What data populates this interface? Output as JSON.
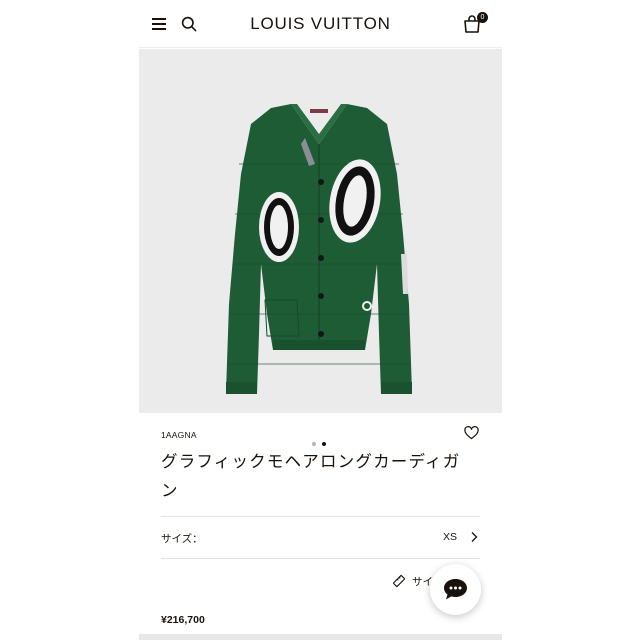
{
  "header": {
    "brand": "LOUIS VUITTON",
    "bag_count": "0"
  },
  "gallery": {
    "total_images": 2,
    "active_index": 1,
    "background": "#ebebeb"
  },
  "product": {
    "sku": "1AAGNA",
    "name": "グラフィックモヘアロングカーディガン",
    "main_color": "#1e5c36",
    "size": {
      "label": "サイズ：",
      "value": "XS"
    },
    "size_guide_label": "サイ",
    "price": "¥216,700"
  },
  "colors": {
    "text": "#19110b",
    "dot_active": "#19110b",
    "dot_inactive": "#b5b5b5"
  }
}
